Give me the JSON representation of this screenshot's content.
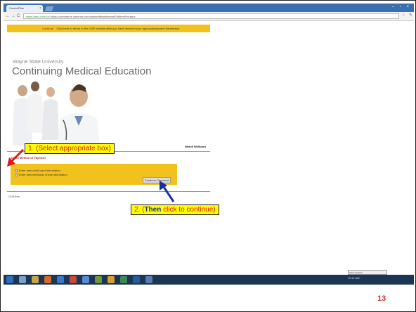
{
  "browser": {
    "tab_title": "CoursePlan",
    "tab_close": "×",
    "window_controls": "– ▫ ×",
    "nav": {
      "back": "←",
      "forward": "→",
      "reload": "C"
    },
    "address_secure": "https://wsu.cme.cc/",
    "address_rest": "https://commerce.cashnet.com/cashnetfb/selfserve/EditItemPrf.aspx"
  },
  "banner": {
    "text": "Click here to return to the CME website after you have received your approval/payment transaction.",
    "link_label": "Continue"
  },
  "header": {
    "university": "Wayne State University",
    "title": "Continuing Medical Education"
  },
  "page": {
    "tag_line": "Wendi Wellburn",
    "section_title": "Select Method of Payment",
    "options": [
      {
        "label": "Enter new credit card information."
      },
      {
        "label": "Enter new electronic check information."
      }
    ],
    "continue_button": "Continue Checkout",
    "footer": "CASHNet"
  },
  "annotations": {
    "callout_1": "1. (Select appropriate box)",
    "callout_2_then": "Then",
    "callout_2_open": "2. (",
    "callout_2_rest": " click to continue)"
  },
  "taskbar": {
    "tooltip": "Show desktop",
    "tray_time": "10:11 AM"
  },
  "slide": {
    "page_number": "13"
  },
  "colors": {
    "banner": "#f1c21c",
    "callout_bg": "#ffff00",
    "callout_text": "#e01818",
    "arrow": "#1a2ea8",
    "arrow_red": "#e01818",
    "page_number": "#c0392b"
  }
}
